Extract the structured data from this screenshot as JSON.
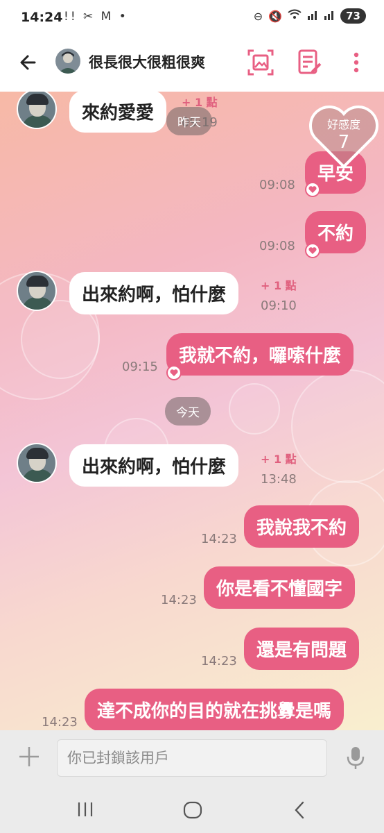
{
  "status": {
    "time": "14:24",
    "notif_icons": "!! ✂ M •",
    "battery": "73"
  },
  "header": {
    "title": "很長很大很粗很爽"
  },
  "affinity": {
    "label": "好感度",
    "value": "7"
  },
  "messages": [
    {
      "side": "in",
      "text": "來約愛愛",
      "points": "+ 1 點",
      "time": "09:19"
    },
    {
      "side": "out",
      "text": "早安",
      "time": "09:08"
    },
    {
      "side": "out",
      "text": "不約",
      "time": "09:08"
    },
    {
      "side": "in",
      "text": "出來約啊，怕什麼",
      "points": "+ 1 點",
      "time": "09:10"
    },
    {
      "side": "out",
      "text": "我就不約，囉嗦什麼",
      "time": "09:15"
    },
    {
      "side": "in",
      "text": "出來約啊，怕什麼",
      "points": "+ 1 點",
      "time": "13:48"
    },
    {
      "side": "out",
      "text": "我說我不約",
      "time": "14:23"
    },
    {
      "side": "out",
      "text": "你是看不懂國字",
      "time": "14:23"
    },
    {
      "side": "out",
      "text": "還是有問題",
      "time": "14:23"
    },
    {
      "side": "out",
      "text": "達不成你的目的就在挑釁是嗎",
      "time": "14:23"
    }
  ],
  "day_separators": {
    "yesterday": "昨天",
    "today": "今天"
  },
  "input": {
    "placeholder": "你已封鎖該用戶"
  },
  "colors": {
    "accent": "#e85f83",
    "points": "#e0607e"
  }
}
